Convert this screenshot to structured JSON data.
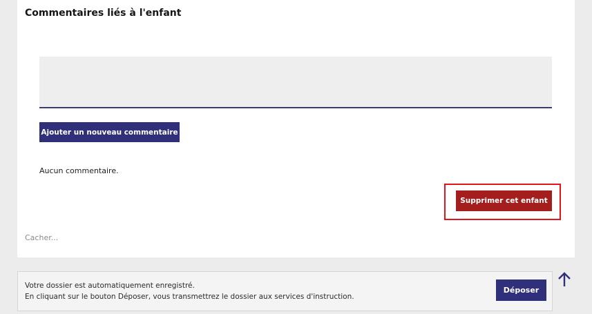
{
  "section": {
    "title": "Commentaires liés à l'enfant"
  },
  "comment": {
    "input_value": "",
    "add_button_label": "Ajouter un nouveau commentaire",
    "empty_text": "Aucun commentaire."
  },
  "child": {
    "delete_button_label": "Supprimer cet enfant",
    "hide_link_label": "Cacher..."
  },
  "footer": {
    "line1": "Votre dossier est automatiquement enregistré.",
    "line2": "En cliquant sur le bouton Déposer, vous transmettrez le dossier aux services d'instruction.",
    "submit_label": "Déposer"
  },
  "icons": {
    "back_to_top": "arrow-up-icon"
  },
  "colors": {
    "primary": "#2f2f7a",
    "danger": "#a51e1e",
    "highlight": "#e0141a",
    "background": "#ececec"
  }
}
